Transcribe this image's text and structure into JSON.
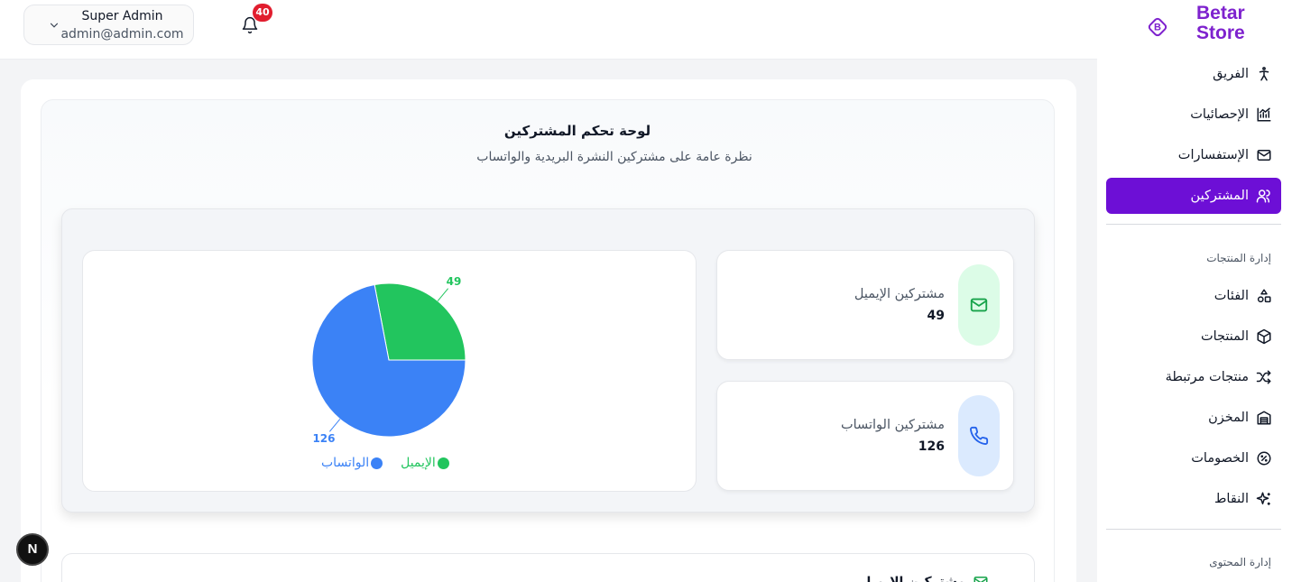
{
  "header": {
    "user_name": "Super Admin",
    "user_email": "admin@admin.com",
    "notification_count": "40"
  },
  "logo": {
    "line1": "Betar",
    "line2": "Store"
  },
  "sidebar": {
    "items_top": [
      {
        "label": "الفريق",
        "icon": "person-icon"
      },
      {
        "label": "الإحصائيات",
        "icon": "chart-icon"
      },
      {
        "label": "الإستفسارات",
        "icon": "mail-icon"
      },
      {
        "label": "المشتركين",
        "icon": "users-icon",
        "active": true
      }
    ],
    "section_products": "إدارة المنتجات",
    "items_products": [
      {
        "label": "الفئات",
        "icon": "shapes-icon"
      },
      {
        "label": "المنتجات",
        "icon": "box-icon"
      },
      {
        "label": "منتجات مرتبطة",
        "icon": "shuffle-icon"
      },
      {
        "label": "المخزن",
        "icon": "warehouse-icon"
      },
      {
        "label": "الخصومات",
        "icon": "percent-badge-icon"
      },
      {
        "label": "النقاط",
        "icon": "sparkles-icon"
      }
    ],
    "section_content": "إدارة المحتوى"
  },
  "main": {
    "title": "لوحة تحكم المشتركين",
    "subtitle": "نظرة عامة على مشتركين النشرة البريدية والواتساب",
    "stats": [
      {
        "label": "مشتركين الإيميل",
        "value": "49",
        "icon": "mail-icon",
        "color": "#16a34a",
        "bg": "#dcfce7"
      },
      {
        "label": "مشتركين الواتساب",
        "value": "126",
        "icon": "phone-icon",
        "color": "#2563eb",
        "bg": "#dbeafe"
      }
    ],
    "bottom_card_title": "مشتركين الإيميل"
  },
  "chart_data": {
    "type": "pie",
    "categories": [
      "الإيميل",
      "الواتساب"
    ],
    "values": [
      49,
      126
    ],
    "colors": [
      "#22c55e",
      "#3b82f6"
    ],
    "data_labels": [
      "49",
      "126"
    ],
    "legend": "bottom"
  },
  "badge": {
    "letter": "N"
  }
}
